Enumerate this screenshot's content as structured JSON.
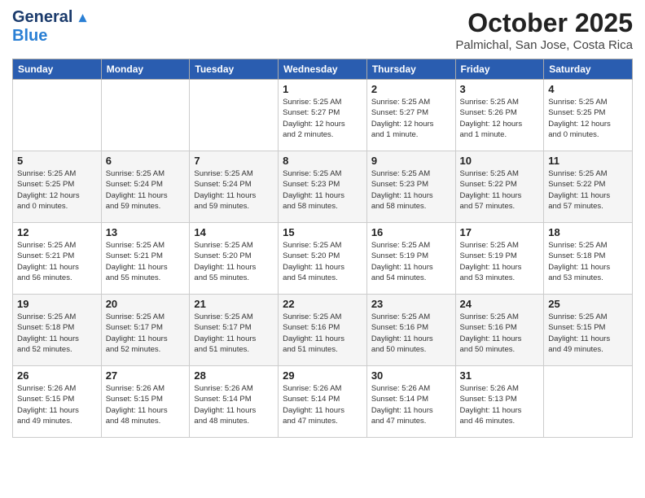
{
  "header": {
    "logo_line1": "General",
    "logo_line2": "Blue",
    "month_title": "October 2025",
    "location": "Palmichal, San Jose, Costa Rica"
  },
  "days_of_week": [
    "Sunday",
    "Monday",
    "Tuesday",
    "Wednesday",
    "Thursday",
    "Friday",
    "Saturday"
  ],
  "weeks": [
    [
      {
        "day": "",
        "info": ""
      },
      {
        "day": "",
        "info": ""
      },
      {
        "day": "",
        "info": ""
      },
      {
        "day": "1",
        "info": "Sunrise: 5:25 AM\nSunset: 5:27 PM\nDaylight: 12 hours\nand 2 minutes."
      },
      {
        "day": "2",
        "info": "Sunrise: 5:25 AM\nSunset: 5:27 PM\nDaylight: 12 hours\nand 1 minute."
      },
      {
        "day": "3",
        "info": "Sunrise: 5:25 AM\nSunset: 5:26 PM\nDaylight: 12 hours\nand 1 minute."
      },
      {
        "day": "4",
        "info": "Sunrise: 5:25 AM\nSunset: 5:25 PM\nDaylight: 12 hours\nand 0 minutes."
      }
    ],
    [
      {
        "day": "5",
        "info": "Sunrise: 5:25 AM\nSunset: 5:25 PM\nDaylight: 12 hours\nand 0 minutes."
      },
      {
        "day": "6",
        "info": "Sunrise: 5:25 AM\nSunset: 5:24 PM\nDaylight: 11 hours\nand 59 minutes."
      },
      {
        "day": "7",
        "info": "Sunrise: 5:25 AM\nSunset: 5:24 PM\nDaylight: 11 hours\nand 59 minutes."
      },
      {
        "day": "8",
        "info": "Sunrise: 5:25 AM\nSunset: 5:23 PM\nDaylight: 11 hours\nand 58 minutes."
      },
      {
        "day": "9",
        "info": "Sunrise: 5:25 AM\nSunset: 5:23 PM\nDaylight: 11 hours\nand 58 minutes."
      },
      {
        "day": "10",
        "info": "Sunrise: 5:25 AM\nSunset: 5:22 PM\nDaylight: 11 hours\nand 57 minutes."
      },
      {
        "day": "11",
        "info": "Sunrise: 5:25 AM\nSunset: 5:22 PM\nDaylight: 11 hours\nand 57 minutes."
      }
    ],
    [
      {
        "day": "12",
        "info": "Sunrise: 5:25 AM\nSunset: 5:21 PM\nDaylight: 11 hours\nand 56 minutes."
      },
      {
        "day": "13",
        "info": "Sunrise: 5:25 AM\nSunset: 5:21 PM\nDaylight: 11 hours\nand 55 minutes."
      },
      {
        "day": "14",
        "info": "Sunrise: 5:25 AM\nSunset: 5:20 PM\nDaylight: 11 hours\nand 55 minutes."
      },
      {
        "day": "15",
        "info": "Sunrise: 5:25 AM\nSunset: 5:20 PM\nDaylight: 11 hours\nand 54 minutes."
      },
      {
        "day": "16",
        "info": "Sunrise: 5:25 AM\nSunset: 5:19 PM\nDaylight: 11 hours\nand 54 minutes."
      },
      {
        "day": "17",
        "info": "Sunrise: 5:25 AM\nSunset: 5:19 PM\nDaylight: 11 hours\nand 53 minutes."
      },
      {
        "day": "18",
        "info": "Sunrise: 5:25 AM\nSunset: 5:18 PM\nDaylight: 11 hours\nand 53 minutes."
      }
    ],
    [
      {
        "day": "19",
        "info": "Sunrise: 5:25 AM\nSunset: 5:18 PM\nDaylight: 11 hours\nand 52 minutes."
      },
      {
        "day": "20",
        "info": "Sunrise: 5:25 AM\nSunset: 5:17 PM\nDaylight: 11 hours\nand 52 minutes."
      },
      {
        "day": "21",
        "info": "Sunrise: 5:25 AM\nSunset: 5:17 PM\nDaylight: 11 hours\nand 51 minutes."
      },
      {
        "day": "22",
        "info": "Sunrise: 5:25 AM\nSunset: 5:16 PM\nDaylight: 11 hours\nand 51 minutes."
      },
      {
        "day": "23",
        "info": "Sunrise: 5:25 AM\nSunset: 5:16 PM\nDaylight: 11 hours\nand 50 minutes."
      },
      {
        "day": "24",
        "info": "Sunrise: 5:25 AM\nSunset: 5:16 PM\nDaylight: 11 hours\nand 50 minutes."
      },
      {
        "day": "25",
        "info": "Sunrise: 5:25 AM\nSunset: 5:15 PM\nDaylight: 11 hours\nand 49 minutes."
      }
    ],
    [
      {
        "day": "26",
        "info": "Sunrise: 5:26 AM\nSunset: 5:15 PM\nDaylight: 11 hours\nand 49 minutes."
      },
      {
        "day": "27",
        "info": "Sunrise: 5:26 AM\nSunset: 5:15 PM\nDaylight: 11 hours\nand 48 minutes."
      },
      {
        "day": "28",
        "info": "Sunrise: 5:26 AM\nSunset: 5:14 PM\nDaylight: 11 hours\nand 48 minutes."
      },
      {
        "day": "29",
        "info": "Sunrise: 5:26 AM\nSunset: 5:14 PM\nDaylight: 11 hours\nand 47 minutes."
      },
      {
        "day": "30",
        "info": "Sunrise: 5:26 AM\nSunset: 5:14 PM\nDaylight: 11 hours\nand 47 minutes."
      },
      {
        "day": "31",
        "info": "Sunrise: 5:26 AM\nSunset: 5:13 PM\nDaylight: 11 hours\nand 46 minutes."
      },
      {
        "day": "",
        "info": ""
      }
    ]
  ]
}
